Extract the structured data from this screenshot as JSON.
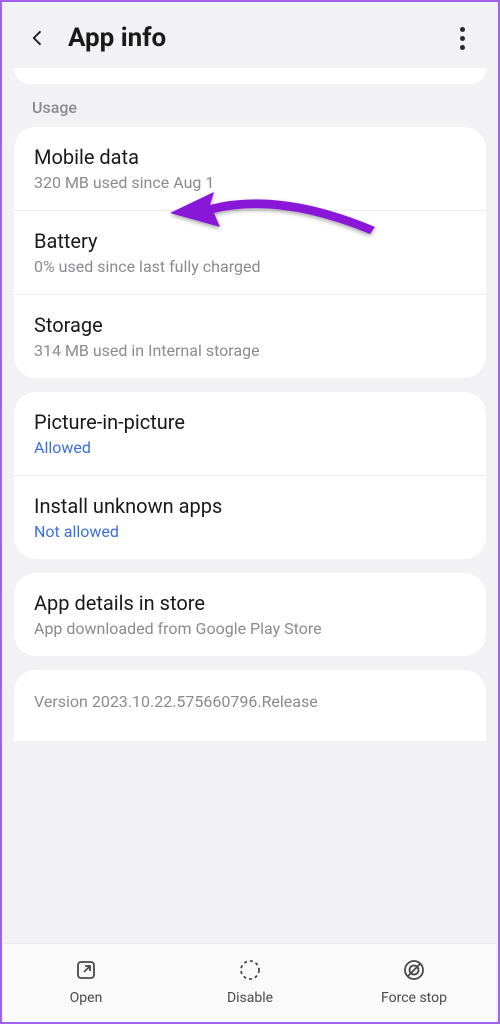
{
  "header": {
    "title": "App info"
  },
  "section_label": "Usage",
  "usage": {
    "items": [
      {
        "title": "Mobile data",
        "sub": "320 MB used since Aug 1",
        "link": false
      },
      {
        "title": "Battery",
        "sub": "0% used since last fully charged",
        "link": false
      },
      {
        "title": "Storage",
        "sub": "314 MB used in Internal storage",
        "link": false
      }
    ]
  },
  "perms": {
    "items": [
      {
        "title": "Picture-in-picture",
        "sub": "Allowed",
        "link": true
      },
      {
        "title": "Install unknown apps",
        "sub": "Not allowed",
        "link": true
      }
    ]
  },
  "store": {
    "title": "App details in store",
    "sub": "App downloaded from Google Play Store"
  },
  "version": "Version 2023.10.22.575660796.Release",
  "bottom": {
    "open": "Open",
    "disable": "Disable",
    "force_stop": "Force stop"
  },
  "annotation_arrow_color": "#8a16d8"
}
